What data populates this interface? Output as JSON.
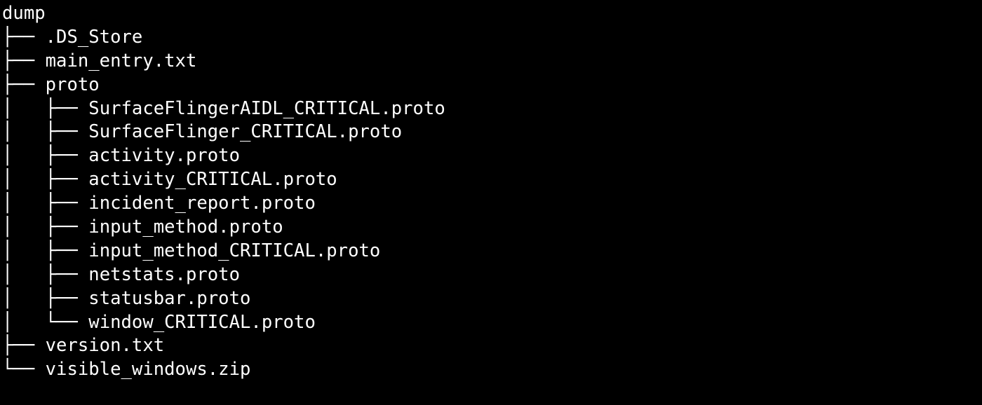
{
  "terminal": {
    "background_color": "#000000",
    "foreground_color": "#ffffff",
    "connector_branch": "├── ",
    "connector_last": "└── ",
    "connector_vertical": "│   ",
    "connector_blank": "    "
  },
  "tree": {
    "root_label": "dump",
    "nodes": [
      {
        "name": ".DS_Store",
        "type": "file",
        "depth": 1,
        "last": false,
        "prefix": "├── ",
        "line": "├── .DS_Store"
      },
      {
        "name": "main_entry.txt",
        "type": "file",
        "depth": 1,
        "last": false,
        "prefix": "├── ",
        "line": "├── main_entry.txt"
      },
      {
        "name": "proto",
        "type": "directory",
        "depth": 1,
        "last": false,
        "prefix": "├── ",
        "line": "├── proto"
      },
      {
        "name": "SurfaceFlingerAIDL_CRITICAL.proto",
        "type": "file",
        "depth": 2,
        "last": false,
        "prefix": "│   ├── ",
        "line": "│   ├── SurfaceFlingerAIDL_CRITICAL.proto"
      },
      {
        "name": "SurfaceFlinger_CRITICAL.proto",
        "type": "file",
        "depth": 2,
        "last": false,
        "prefix": "│   ├── ",
        "line": "│   ├── SurfaceFlinger_CRITICAL.proto"
      },
      {
        "name": "activity.proto",
        "type": "file",
        "depth": 2,
        "last": false,
        "prefix": "│   ├── ",
        "line": "│   ├── activity.proto"
      },
      {
        "name": "activity_CRITICAL.proto",
        "type": "file",
        "depth": 2,
        "last": false,
        "prefix": "│   ├── ",
        "line": "│   ├── activity_CRITICAL.proto"
      },
      {
        "name": "incident_report.proto",
        "type": "file",
        "depth": 2,
        "last": false,
        "prefix": "│   ├── ",
        "line": "│   ├── incident_report.proto"
      },
      {
        "name": "input_method.proto",
        "type": "file",
        "depth": 2,
        "last": false,
        "prefix": "│   ├── ",
        "line": "│   ├── input_method.proto"
      },
      {
        "name": "input_method_CRITICAL.proto",
        "type": "file",
        "depth": 2,
        "last": false,
        "prefix": "│   ├── ",
        "line": "│   ├── input_method_CRITICAL.proto"
      },
      {
        "name": "netstats.proto",
        "type": "file",
        "depth": 2,
        "last": false,
        "prefix": "│   ├── ",
        "line": "│   ├── netstats.proto"
      },
      {
        "name": "statusbar.proto",
        "type": "file",
        "depth": 2,
        "last": false,
        "prefix": "│   ├── ",
        "line": "│   ├── statusbar.proto"
      },
      {
        "name": "window_CRITICAL.proto",
        "type": "file",
        "depth": 2,
        "last": true,
        "prefix": "│   └── ",
        "line": "│   └── window_CRITICAL.proto"
      },
      {
        "name": "version.txt",
        "type": "file",
        "depth": 1,
        "last": false,
        "prefix": "├── ",
        "line": "├── version.txt"
      },
      {
        "name": "visible_windows.zip",
        "type": "file",
        "depth": 1,
        "last": true,
        "prefix": "└── ",
        "line": "└── visible_windows.zip"
      }
    ]
  }
}
